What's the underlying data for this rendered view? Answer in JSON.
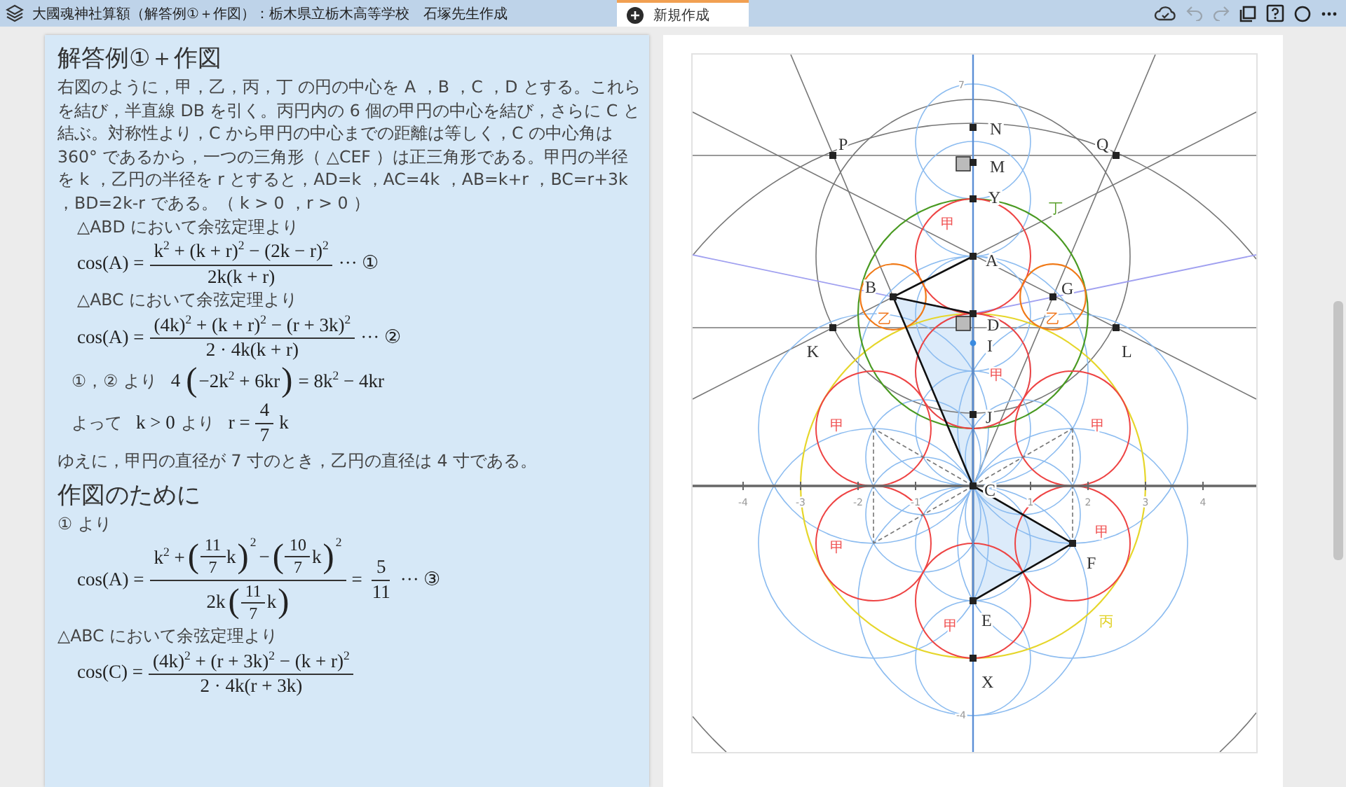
{
  "header": {
    "title": "大國魂神社算額（解答例①＋作図）：栃木県立栃木高等学校　石塚先生作成",
    "tab": {
      "label": "新規作成"
    },
    "toolbar": [
      {
        "kind": "cloud",
        "disabled": false
      },
      {
        "kind": "undo",
        "disabled": true
      },
      {
        "kind": "redo",
        "disabled": true
      },
      {
        "kind": "pages",
        "disabled": false
      },
      {
        "kind": "help",
        "disabled": false
      },
      {
        "kind": "circle",
        "disabled": false
      },
      {
        "kind": "more",
        "disabled": false
      }
    ]
  },
  "sections": [
    {
      "heading": "解答例①＋作図",
      "body": [
        {
          "kind": "paragraph",
          "text": "右図のように，甲，乙，丙，丁 の円の中心を A ，B ，C ，D とする。これらを結び，半直線 DB を引く。丙円内の 6 個の甲円の中心を結び，さらに C と結ぶ。対称性より，C から甲円の中心までの距離は等しく，C の中心角は 360° であるから，一つの三角形（ △CEF ）は正三角形である。甲円の半径を k ，乙円の半径を r とすると，AD=k ，AC=4k ，AB=k+r ，BC=r+3k ，BD=2k-r である。（ k > 0 ，r > 0 ）"
        },
        {
          "kind": "note",
          "text": "△ABD において余弦定理より"
        },
        {
          "kind": "equation",
          "segments": [
            {
              "kind": "math",
              "text": "cos(A) ="
            },
            {
              "kind": "frac",
              "num": [
                {
                  "kind": "math",
                  "text": "k$^{2}$ + (k + r)$^{2}$ − (2k − r)$^{2}$"
                }
              ],
              "den": [
                {
                  "kind": "math",
                  "text": "2k(k + r)"
                }
              ]
            },
            {
              "kind": "math",
              "text": "··· ①"
            }
          ]
        },
        {
          "kind": "note",
          "text": "△ABC において余弦定理より"
        },
        {
          "kind": "equation",
          "segments": [
            {
              "kind": "math",
              "text": "cos(A) ="
            },
            {
              "kind": "frac",
              "num": [
                {
                  "kind": "math",
                  "text": "(4k)$^{2}$ + (k + r)$^{2}$ − (r + 3k)$^{2}$"
                }
              ],
              "den": [
                {
                  "kind": "math",
                  "text": "2 · 4k(k + r)"
                }
              ]
            },
            {
              "kind": "math",
              "text": "··· ②"
            }
          ]
        },
        {
          "kind": "line",
          "segments": [
            {
              "kind": "text",
              "text": "①，② より"
            },
            {
              "kind": "math",
              "text": "4"
            },
            {
              "kind": "paren",
              "open": "(",
              "close": ")",
              "body": [
                {
                  "kind": "math",
                  "text": "−2k$^{2}$ + 6kr"
                }
              ]
            },
            {
              "kind": "math",
              "text": "= 8k$^{2}$ − 4kr"
            }
          ]
        },
        {
          "kind": "line",
          "segments": [
            {
              "kind": "text",
              "text": "よって"
            },
            {
              "kind": "math",
              "text": "k > 0"
            },
            {
              "kind": "text",
              "text": "より"
            },
            {
              "kind": "math",
              "text": "r ="
            },
            {
              "kind": "frac",
              "num": [
                {
                  "kind": "math",
                  "text": "4"
                }
              ],
              "den": [
                {
                  "kind": "math",
                  "text": "7"
                }
              ]
            },
            {
              "kind": "math",
              "text": "k"
            }
          ]
        },
        {
          "kind": "paragraph",
          "text": "ゆえに，甲円の直径が 7 寸のとき，乙円の直径は 4 寸である。"
        }
      ]
    },
    {
      "heading": "作図のために",
      "body": [
        {
          "kind": "paragraph",
          "text": "① より"
        },
        {
          "kind": "equation",
          "segments": [
            {
              "kind": "math",
              "text": "cos(A) ="
            },
            {
              "kind": "frac",
              "num": [
                {
                  "kind": "math",
                  "text": "k$^{2}$ +"
                },
                {
                  "kind": "paren",
                  "open": "(",
                  "close": ")",
                  "sup": "2",
                  "body": [
                    {
                      "kind": "frac",
                      "num": [
                        {
                          "kind": "math",
                          "text": "11"
                        }
                      ],
                      "den": [
                        {
                          "kind": "math",
                          "text": "7"
                        }
                      ]
                    },
                    {
                      "kind": "math",
                      "text": "k"
                    }
                  ]
                },
                {
                  "kind": "math",
                  "text": "−"
                },
                {
                  "kind": "paren",
                  "open": "(",
                  "close": ")",
                  "sup": "2",
                  "body": [
                    {
                      "kind": "frac",
                      "num": [
                        {
                          "kind": "math",
                          "text": "10"
                        }
                      ],
                      "den": [
                        {
                          "kind": "math",
                          "text": "7"
                        }
                      ]
                    },
                    {
                      "kind": "math",
                      "text": "k"
                    }
                  ]
                }
              ],
              "den": [
                {
                  "kind": "math",
                  "text": "2k"
                },
                {
                  "kind": "paren",
                  "open": "(",
                  "close": ")",
                  "body": [
                    {
                      "kind": "frac",
                      "num": [
                        {
                          "kind": "math",
                          "text": "11"
                        }
                      ],
                      "den": [
                        {
                          "kind": "math",
                          "text": "7"
                        }
                      ]
                    },
                    {
                      "kind": "math",
                      "text": "k"
                    }
                  ]
                }
              ]
            },
            {
              "kind": "math",
              "text": "="
            },
            {
              "kind": "frac",
              "num": [
                {
                  "kind": "math",
                  "text": "5"
                }
              ],
              "den": [
                {
                  "kind": "math",
                  "text": "11"
                }
              ]
            },
            {
              "kind": "math",
              "text": "··· ③"
            }
          ]
        },
        {
          "kind": "paragraph",
          "text": "△ABC において余弦定理より"
        },
        {
          "kind": "equation",
          "segments": [
            {
              "kind": "math",
              "text": "cos(C) ="
            },
            {
              "kind": "frac",
              "num": [
                {
                  "kind": "math",
                  "text": "(4k)$^{2}$ + (r + 3k)$^{2}$ − (k + r)$^{2}$"
                }
              ],
              "den": [
                {
                  "kind": "math",
                  "text": "2 · 4k(r + 3k)"
                }
              ]
            }
          ]
        }
      ]
    }
  ],
  "diagram": {
    "x_ticks": [
      "-4",
      "-3",
      "-2",
      "-1",
      "1",
      "2",
      "3",
      "4"
    ],
    "y_ticks": [
      "7",
      "-4"
    ],
    "points": [
      {
        "label": "N"
      },
      {
        "label": "M"
      },
      {
        "label": "Y"
      },
      {
        "label": "A"
      },
      {
        "label": "P"
      },
      {
        "label": "Q"
      },
      {
        "label": "B"
      },
      {
        "label": "G"
      },
      {
        "label": "D"
      },
      {
        "label": "K"
      },
      {
        "label": "I"
      },
      {
        "label": "L"
      },
      {
        "label": "J"
      },
      {
        "label": "C"
      },
      {
        "label": "F"
      },
      {
        "label": "E"
      },
      {
        "label": "X"
      }
    ],
    "circle_labels": [
      {
        "label": "丁",
        "color": "#5aa02c"
      },
      {
        "label": "甲",
        "color": "#f05050"
      },
      {
        "label": "乙",
        "color": "#f07820"
      },
      {
        "label": "乙",
        "color": "#f07820"
      },
      {
        "label": "甲",
        "color": "#f05050"
      },
      {
        "label": "甲",
        "color": "#f05050"
      },
      {
        "label": "甲",
        "color": "#f05050"
      },
      {
        "label": "甲",
        "color": "#f05050"
      },
      {
        "label": "甲",
        "color": "#f05050"
      },
      {
        "label": "丙",
        "color": "#e0d020"
      },
      {
        "label": "甲",
        "color": "#f05050"
      }
    ]
  }
}
